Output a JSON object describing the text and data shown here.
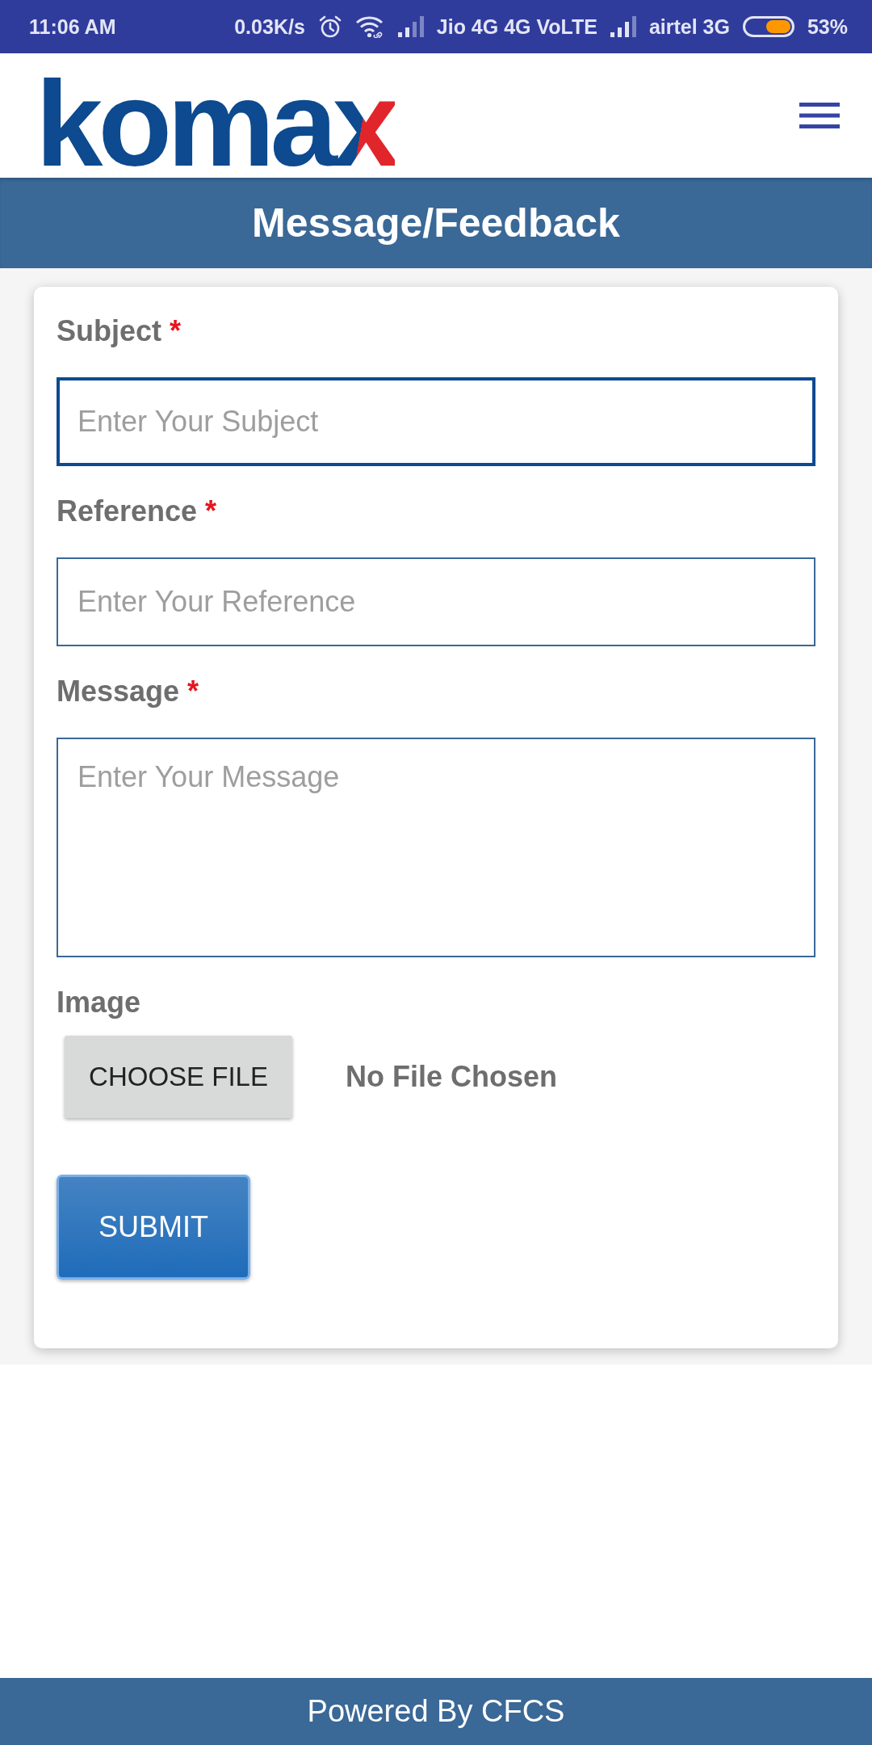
{
  "status_bar": {
    "time": "11:06 AM",
    "speed": "0.03K/s",
    "carrier_1": "Jio 4G 4G VoLTE",
    "carrier_2": "airtel 3G",
    "battery": "53%"
  },
  "header": {
    "logo": "komax"
  },
  "title_bar": {
    "title": "Message/Feedback"
  },
  "form": {
    "fields": [
      {
        "kind": "input",
        "label": "Subject",
        "required_mark": "*",
        "placeholder": "Enter Your Subject",
        "focused": true
      },
      {
        "kind": "input",
        "label": "Reference",
        "required_mark": "*",
        "placeholder": "Enter Your Reference",
        "focused": false
      },
      {
        "kind": "textarea",
        "label": "Message",
        "required_mark": "*",
        "placeholder": "Enter Your Message",
        "focused": false
      }
    ],
    "image": {
      "label": "Image",
      "button": "CHOOSE FILE",
      "status": "No File Chosen"
    },
    "submit": "SUBMIT"
  },
  "footer": {
    "text": "Powered By CFCS"
  }
}
